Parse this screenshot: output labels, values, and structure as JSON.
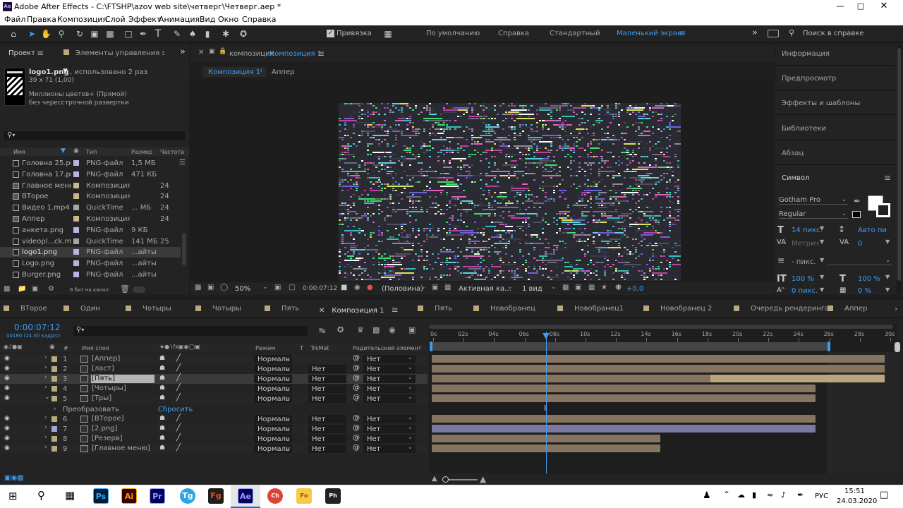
{
  "window": {
    "title": "Adobe After Effects - C:\\FTSHP\\azov web site\\четверг\\Четверг.aep *",
    "app_badge": "Ae"
  },
  "menu": [
    "Файл",
    "Правка",
    "Композиция",
    "Слой",
    "Эффект",
    "Анимация",
    "Вид",
    "Окно",
    "Справка"
  ],
  "toolbar": {
    "snap_label": "Привязка",
    "workspaces": [
      "По умолчанию",
      "Справка",
      "Стандартный",
      "Маленький экран"
    ],
    "search_placeholder": "Поиск в справке"
  },
  "project": {
    "tab_project": "Проект",
    "tab_effects": "Элементы управления эффект",
    "item_name": "logo1.png",
    "item_used": ", использовано 2 раз",
    "item_dims": "39 x 71 (1,00)",
    "item_color": "Миллионы цветов+ (Прямой)",
    "item_interlace": "без чересстрочной развертки",
    "col_name": "Имя",
    "col_type": "Тип",
    "col_size": "Размер",
    "col_fps": "Частота",
    "items": [
      {
        "name": "Головна 25.png",
        "type": "PNG-файл",
        "size": "1,5 МБ",
        "fps": "",
        "color": "#b9b3e0",
        "icon": "png"
      },
      {
        "name": "Головна 17.png",
        "type": "PNG-файл",
        "size": "471 КБ",
        "fps": "",
        "color": "#b9b3e0",
        "icon": "png"
      },
      {
        "name": "Главное меню",
        "type": "Композиция",
        "size": "",
        "fps": "24",
        "color": "#c9b88d",
        "icon": "comp"
      },
      {
        "name": "ВТорое",
        "type": "Композиция",
        "size": "",
        "fps": "24",
        "color": "#c9b88d",
        "icon": "comp"
      },
      {
        "name": "Видео 1.mp4",
        "type": "QuickTime",
        "size": "... МБ",
        "fps": "24",
        "color": "#a6a6a6",
        "icon": "video"
      },
      {
        "name": "Аппер",
        "type": "Композиция",
        "size": "",
        "fps": "24",
        "color": "#c9b88d",
        "icon": "comp"
      },
      {
        "name": "анкета.png",
        "type": "PNG-файл",
        "size": "9 КБ",
        "fps": "",
        "color": "#b9b3e0",
        "icon": "png"
      },
      {
        "name": "videopl...ck.mp4",
        "type": "QuickTime",
        "size": "141 МБ",
        "fps": "25",
        "color": "#a6a6a6",
        "icon": "video"
      },
      {
        "name": "logo1.png",
        "type": "PNG-файл",
        "size": "...айты",
        "fps": "",
        "color": "#b9b3e0",
        "icon": "png"
      },
      {
        "name": "Logo.png",
        "type": "PNG-файл",
        "size": "...айты",
        "fps": "",
        "color": "#b9b3e0",
        "icon": "png"
      },
      {
        "name": "Burger.png",
        "type": "PNG-файл",
        "size": "...айты",
        "fps": "",
        "color": "#b9b3e0",
        "icon": "png"
      }
    ],
    "bit_depth": "8 бит на канал"
  },
  "composition": {
    "header_prefix": "композиция",
    "header_name": "Композиция 1",
    "breadcrumb_active": "Композиция 1",
    "breadcrumb_next": "Аппер",
    "zoom": "50%",
    "timecode": "0:00:07:12",
    "resolution": "(Половина)",
    "camera": "Активная ка...",
    "views": "1 вид",
    "exposure": "+0,0"
  },
  "right_panels": [
    "Информация",
    "Предпросмотр",
    "Эффекты и шаблоны",
    "Библиотеки",
    "Абзац",
    "Символ"
  ],
  "character": {
    "font": "Gotham Pro",
    "style": "Regular",
    "size": "14 пикс.",
    "leading": "Авто пи",
    "kerning": "Метрич",
    "tracking": "0",
    "stroke": "- пикс.",
    "vscale": "100 %",
    "hscale": "100 %",
    "baseline": "0 пикс.",
    "tsume": "0 %"
  },
  "timeline": {
    "tabs": [
      {
        "label": "ВТорое",
        "active": false
      },
      {
        "label": "Один",
        "active": false
      },
      {
        "label": "Чотыры",
        "active": false
      },
      {
        "label": "Чотыры",
        "active": false
      },
      {
        "label": "Пять",
        "active": false
      },
      {
        "label": "Композиция 1",
        "active": true
      },
      {
        "label": "Пять",
        "active": false
      },
      {
        "label": "Новобранец",
        "active": false
      },
      {
        "label": "Новобранец1",
        "active": false
      },
      {
        "label": "Новобранец 2",
        "active": false
      },
      {
        "label": "Очередь рендеринга",
        "active": false
      },
      {
        "label": "Аппер",
        "active": false
      }
    ],
    "timecode": "0:00:07:12",
    "frames": "00180 (24.00 кадр/с)",
    "col_layer_name": "Имя слоя",
    "col_mode": "Режим",
    "col_t": "T",
    "col_trkmat": "TrkMat",
    "col_parent": "Родительский элемент ...",
    "ruler": [
      "0s",
      "02s",
      "04s",
      "06s",
      "08s",
      "10s",
      "12s",
      "14s",
      "16s",
      "18s",
      "20s",
      "22s",
      "24s",
      "26s",
      "28s",
      "30s"
    ],
    "transform_label": "Преобразовать",
    "reset_label": "Сбросить",
    "layers": [
      {
        "num": "1",
        "name": "[Аппер]",
        "mode": "Нормаль",
        "trk": "",
        "parent": "Нет",
        "color": "#b9a97e",
        "start": 0.0,
        "end": 0.99,
        "light_start": -1,
        "selected": false
      },
      {
        "num": "2",
        "name": "[ласт]",
        "mode": "Нормаль",
        "trk": "Нет",
        "parent": "Нет",
        "color": "#b9a97e",
        "start": 0.0,
        "end": 0.99,
        "light_start": -1,
        "selected": false
      },
      {
        "num": "3",
        "name": "[Пять]",
        "mode": "Нормаль",
        "trk": "Нет",
        "parent": "Нет",
        "color": "#b9a97e",
        "start": 0.0,
        "end": 0.99,
        "light_start": 0.61,
        "selected": true
      },
      {
        "num": "4",
        "name": "[Чотыры]",
        "mode": "Нормаль",
        "trk": "Нет",
        "parent": "Нет",
        "color": "#b9a97e",
        "start": 0.0,
        "end": 0.84,
        "light_start": -1,
        "selected": false
      },
      {
        "num": "5",
        "name": "[Тры]",
        "mode": "Нормаль",
        "trk": "Нет",
        "parent": "Нет",
        "color": "#b9a97e",
        "start": 0.0,
        "end": 0.84,
        "light_start": -1,
        "selected": false
      },
      {
        "num": "6",
        "name": "[ВТорое]",
        "mode": "Нормаль",
        "trk": "Нет",
        "parent": "Нет",
        "color": "#b9a97e",
        "start": 0.0,
        "end": 0.84,
        "light_start": -1,
        "selected": false
      },
      {
        "num": "7",
        "name": "[2.png]",
        "mode": "Нормаль",
        "trk": "Нет",
        "parent": "Нет",
        "color": "#a3a3d8",
        "start": 0.0,
        "end": 0.84,
        "light_start": -1,
        "selected": false
      },
      {
        "num": "8",
        "name": "[Резерв]",
        "mode": "Нормаль",
        "trk": "Нет",
        "parent": "Нет",
        "color": "#b9a97e",
        "start": 0.0,
        "end": 0.5,
        "light_start": -1,
        "selected": false
      },
      {
        "num": "9",
        "name": "[Главное меню]",
        "mode": "Нормаль",
        "trk": "Нет",
        "parent": "Нет",
        "color": "#b9a97e",
        "start": 0.0,
        "end": 0.5,
        "light_start": -1,
        "selected": false
      }
    ],
    "playhead_fraction": 0.25
  },
  "taskbar": {
    "lang": "РУС",
    "time": "15:51",
    "date": "24.03.2020",
    "apps": [
      "Ps",
      "Ai",
      "Pr",
      "Tg",
      "Fg",
      "Ae",
      "Ch",
      "Fo",
      "Ph"
    ]
  }
}
